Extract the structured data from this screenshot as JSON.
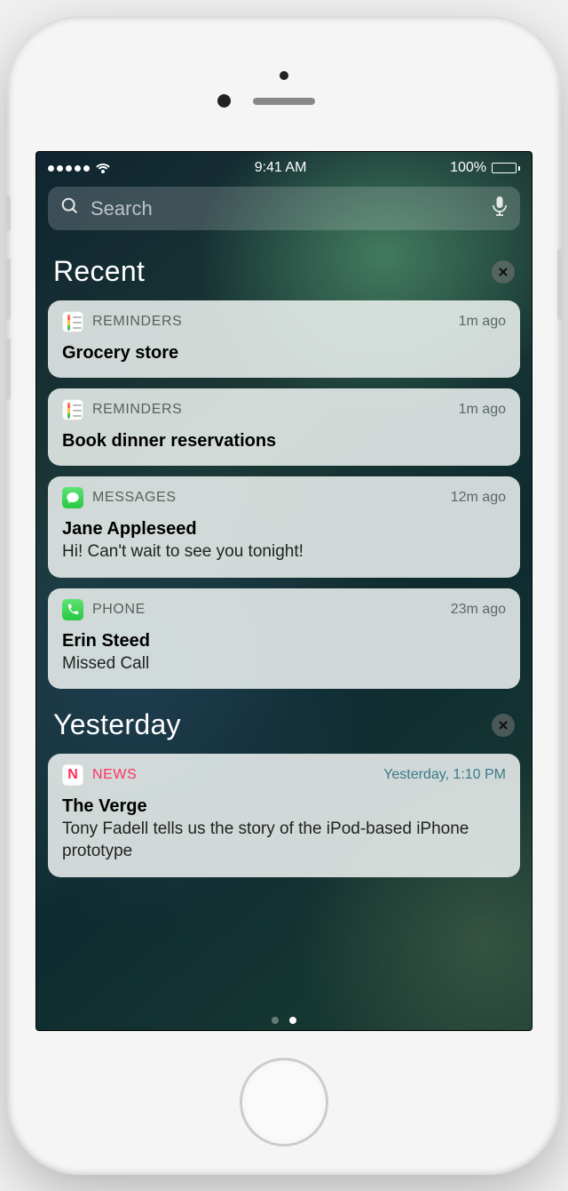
{
  "status": {
    "time": "9:41 AM",
    "battery_pct": "100%"
  },
  "search": {
    "placeholder": "Search"
  },
  "sections": [
    {
      "title": "Recent",
      "cards": [
        {
          "app": "REMINDERS",
          "time": "1m ago",
          "title": "Grocery store",
          "subtitle": ""
        },
        {
          "app": "REMINDERS",
          "time": "1m ago",
          "title": "Book dinner reservations",
          "subtitle": ""
        },
        {
          "app": "MESSAGES",
          "time": "12m ago",
          "title": "Jane Appleseed",
          "subtitle": "Hi! Can't wait to see you tonight!"
        },
        {
          "app": "PHONE",
          "time": "23m ago",
          "title": "Erin Steed",
          "subtitle": "Missed Call"
        }
      ]
    },
    {
      "title": "Yesterday",
      "cards": [
        {
          "app": "NEWS",
          "time": "Yesterday, 1:10 PM",
          "title": "The Verge",
          "subtitle": "Tony Fadell tells us the story of the iPod-based iPhone prototype"
        }
      ]
    }
  ]
}
